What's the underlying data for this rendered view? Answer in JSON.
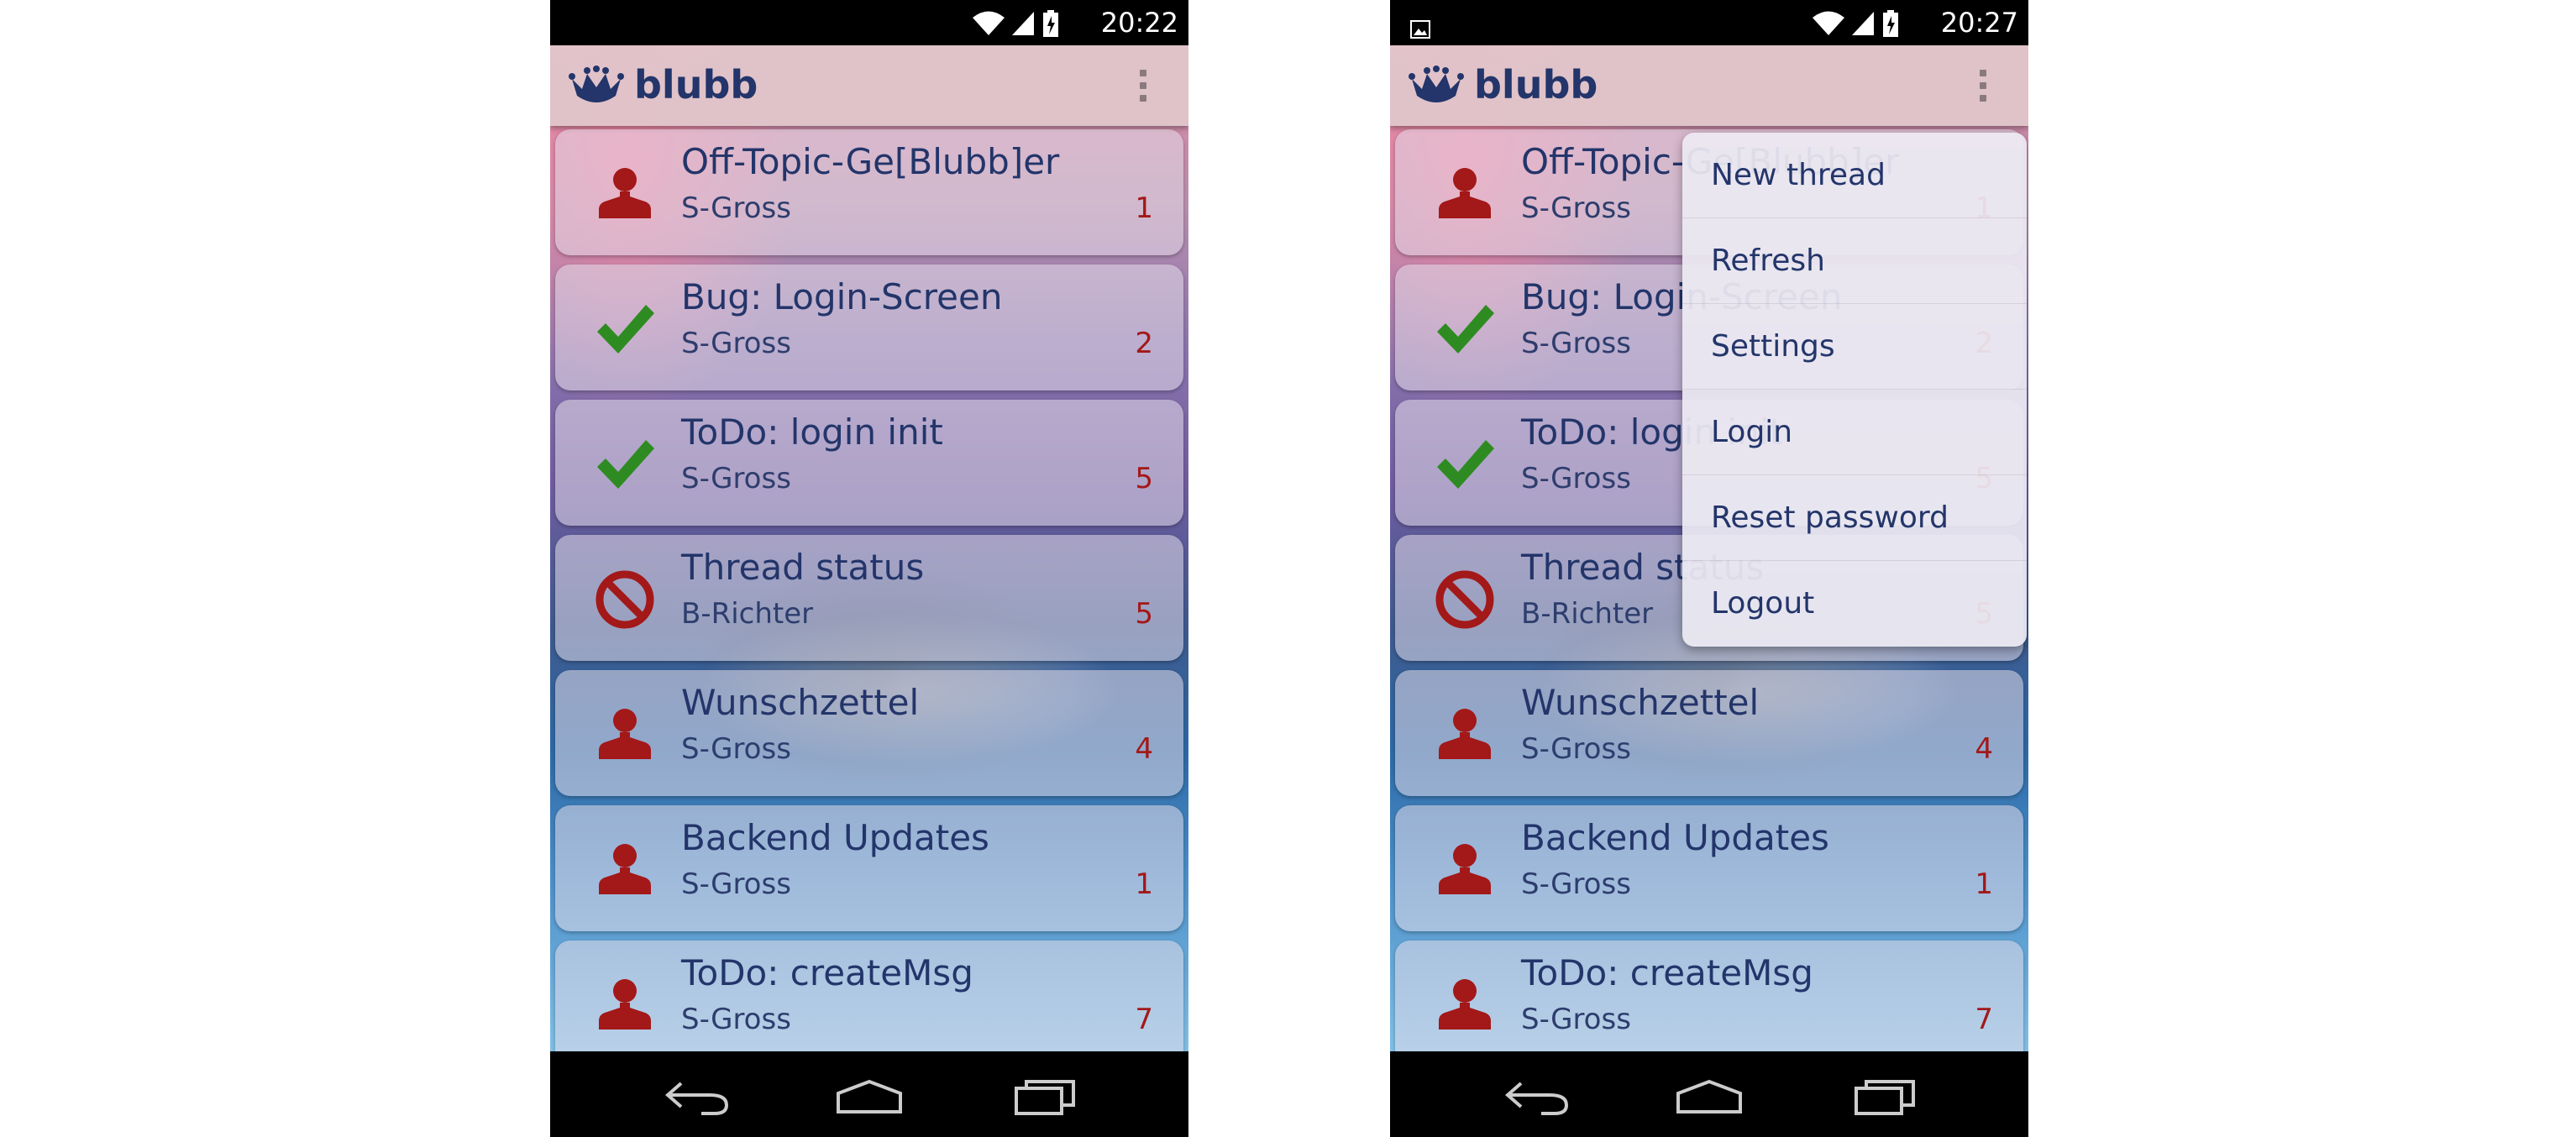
{
  "app": {
    "title": "blubb"
  },
  "colors": {
    "title_text": "#23356a",
    "count_text": "#a31818",
    "status_user": "#a31818",
    "status_done": "#2e8b21",
    "status_closed": "#a31818"
  },
  "screens": [
    {
      "status_time": "20:22",
      "threads": [
        {
          "title": "Off-Topic-Ge[Blubb]er",
          "author": "S-Gross",
          "count": "1",
          "icon": "user-icon"
        },
        {
          "title": "Bug: Login-Screen",
          "author": "S-Gross",
          "count": "2",
          "icon": "checkmark-icon"
        },
        {
          "title": "ToDo: login init",
          "author": "S-Gross",
          "count": "5",
          "icon": "checkmark-icon"
        },
        {
          "title": "Thread status",
          "author": "B-Richter",
          "count": "5",
          "icon": "prohibited-icon"
        },
        {
          "title": "Wunschzettel",
          "author": "S-Gross",
          "count": "4",
          "icon": "user-icon"
        },
        {
          "title": "Backend Updates",
          "author": "S-Gross",
          "count": "1",
          "icon": "user-icon"
        },
        {
          "title": "ToDo: createMsg",
          "author": "S-Gross",
          "count": "7",
          "icon": "user-icon"
        }
      ]
    },
    {
      "status_time": "20:27",
      "threads": [
        {
          "title": "Off-Topic-Ge[Blubb]er",
          "author": "S-Gross",
          "count": "1",
          "icon": "user-icon"
        },
        {
          "title": "Bug: Login-Screen",
          "author": "S-Gross",
          "count": "2",
          "icon": "checkmark-icon"
        },
        {
          "title": "ToDo: login init",
          "author": "S-Gross",
          "count": "5",
          "icon": "checkmark-icon"
        },
        {
          "title": "Thread status",
          "author": "B-Richter",
          "count": "5",
          "icon": "prohibited-icon"
        },
        {
          "title": "Wunschzettel",
          "author": "S-Gross",
          "count": "4",
          "icon": "user-icon"
        },
        {
          "title": "Backend Updates",
          "author": "S-Gross",
          "count": "1",
          "icon": "user-icon"
        },
        {
          "title": "ToDo: createMsg",
          "author": "S-Gross",
          "count": "7",
          "icon": "user-icon"
        }
      ],
      "menu": [
        "New thread",
        "Refresh",
        "Settings",
        "Login",
        "Reset password",
        "Logout"
      ]
    }
  ]
}
